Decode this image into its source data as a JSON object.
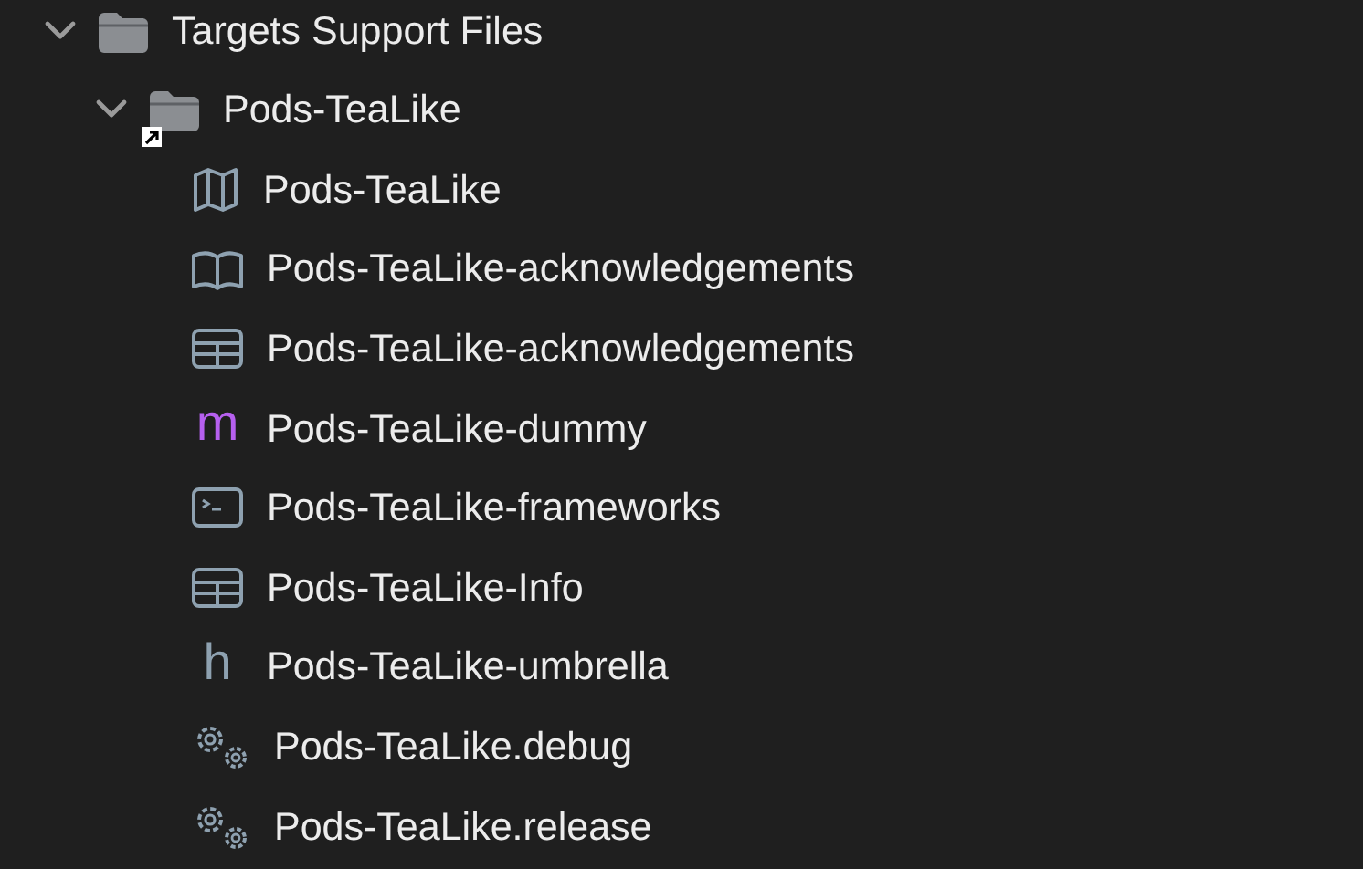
{
  "tree": [
    {
      "label": "Targets Support Files",
      "kind": "folder",
      "expanded": true,
      "children": [
        {
          "label": "Pods-TeaLike",
          "kind": "folder",
          "expanded": true,
          "alias": true,
          "children": [
            {
              "label": "Pods-TeaLike",
              "kind": "modulemap"
            },
            {
              "label": "Pods-TeaLike-acknowledgements",
              "kind": "markdown"
            },
            {
              "label": "Pods-TeaLike-acknowledgements",
              "kind": "plist"
            },
            {
              "label": "Pods-TeaLike-dummy",
              "kind": "source",
              "glyph": "m"
            },
            {
              "label": "Pods-TeaLike-frameworks",
              "kind": "script"
            },
            {
              "label": "Pods-TeaLike-Info",
              "kind": "plist"
            },
            {
              "label": "Pods-TeaLike-umbrella",
              "kind": "header",
              "glyph": "h"
            },
            {
              "label": "Pods-TeaLike.debug",
              "kind": "config"
            },
            {
              "label": "Pods-TeaLike.release",
              "kind": "config"
            }
          ]
        }
      ]
    }
  ]
}
